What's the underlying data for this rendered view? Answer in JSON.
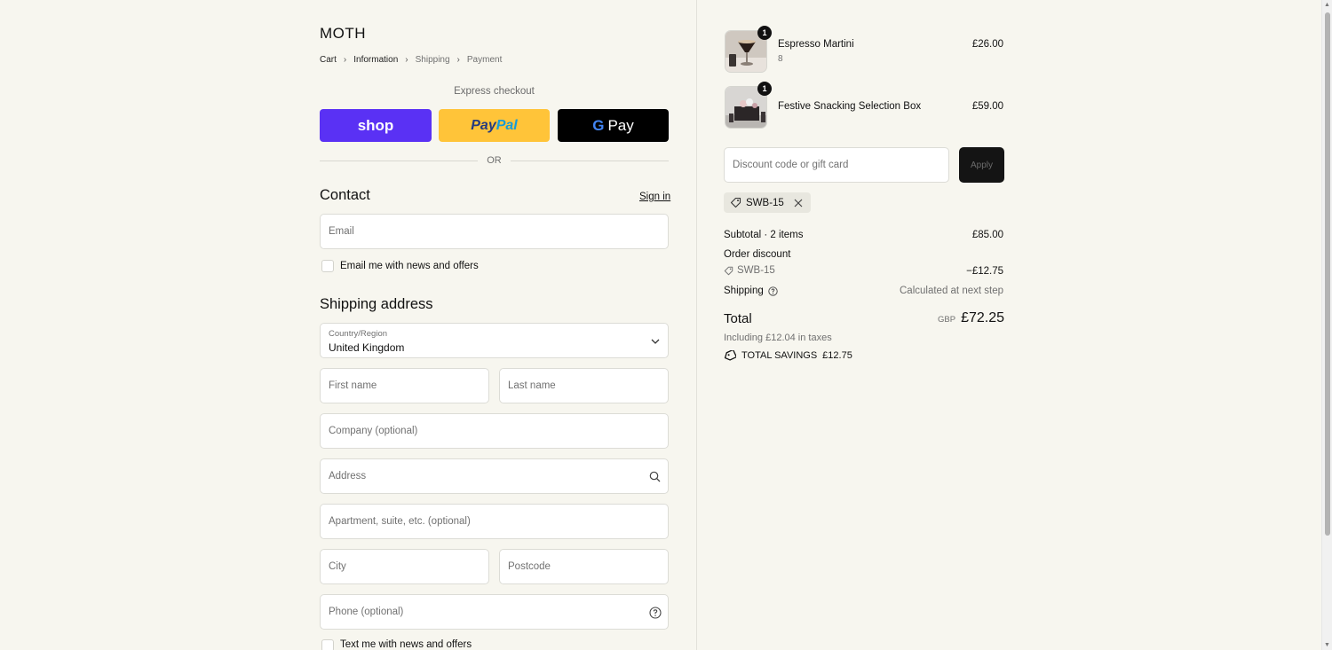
{
  "brand": {
    "logo": "MOTH"
  },
  "breadcrumbs": [
    {
      "label": "Cart"
    },
    {
      "label": "Information"
    },
    {
      "label": "Shipping"
    },
    {
      "label": "Payment"
    }
  ],
  "express": {
    "title": "Express checkout",
    "shop_label": "shop",
    "paypal_part1": "Pay",
    "paypal_part2": "Pal",
    "gpay_g": "G",
    "gpay_label": "Pay",
    "or_label": "OR"
  },
  "contact": {
    "heading": "Contact",
    "sign_in": "Sign in",
    "email_placeholder": "Email",
    "news_label": "Email me with news and offers"
  },
  "shipping": {
    "heading": "Shipping address",
    "country_label": "Country/Region",
    "country_value": "United Kingdom",
    "first_name": "First name",
    "last_name": "Last name",
    "company": "Company (optional)",
    "address": "Address",
    "apartment": "Apartment, suite, etc. (optional)",
    "city": "City",
    "postcode": "Postcode",
    "phone": "Phone (optional)",
    "text_news": "Text me with news and offers"
  },
  "cart": {
    "items": [
      {
        "name": "Espresso Martini",
        "variant": "8",
        "qty": "1",
        "price": "£26.00"
      },
      {
        "name": "Festive Snacking Selection Box",
        "variant": "",
        "qty": "1",
        "price": "£59.00"
      }
    ],
    "discount_placeholder": "Discount code or gift card",
    "apply_label": "Apply",
    "applied_code": "SWB-15"
  },
  "summary": {
    "subtotal_label": "Subtotal · 2 items",
    "subtotal_value": "£85.00",
    "order_discount_label": "Order discount",
    "discount_code": "SWB-15",
    "discount_value": "−£12.75",
    "shipping_label": "Shipping",
    "shipping_value": "Calculated at next step",
    "total_label": "Total",
    "currency": "GBP",
    "total_value": "£72.25",
    "taxes_note": "Including £12.04 in taxes",
    "savings_label": "TOTAL SAVINGS",
    "savings_value": "£12.75"
  },
  "colors": {
    "background": "#f7f6ef",
    "shop_pay": "#5a31f4",
    "paypal": "#ffc439",
    "gpay": "#000000",
    "apply_button": "#141414"
  }
}
